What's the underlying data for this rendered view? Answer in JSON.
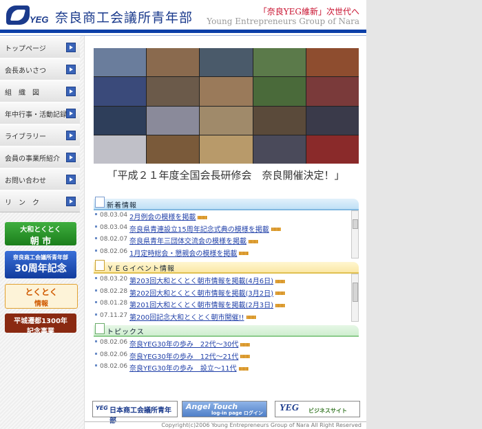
{
  "header": {
    "logo_text": "YEG",
    "site_title": "奈良商工会議所青年部",
    "tagline": "「奈良YEG維新」次世代へ",
    "subtitle": "Young Entrepreneurs Group of Nara"
  },
  "sidebar": {
    "items": [
      {
        "label": "トップページ"
      },
      {
        "label": "会長あいさつ"
      },
      {
        "label": "組　織　図"
      },
      {
        "label": "年中行事・活動記録"
      },
      {
        "label": "ライブラリー"
      },
      {
        "label": "会員の事業所紹介"
      },
      {
        "label": "お問い合わせ"
      },
      {
        "label": "リ　ン　ク"
      }
    ],
    "banners": [
      {
        "line1": "大和とくとく",
        "line2": "朝 市"
      },
      {
        "line1": "奈良商工会議所青年部",
        "line2": "30周年記念"
      },
      {
        "line1": "とくとく",
        "line2": "情報"
      },
      {
        "line1": "平城遷都1300年",
        "line2": "記念事業"
      }
    ]
  },
  "main": {
    "headline": "「平成２１年度全国会長研修会　奈良開催決定！」",
    "news": {
      "title": "新着情報",
      "rows": [
        {
          "date": "08.03.04",
          "text": "2月例会の模様を掲載"
        },
        {
          "date": "08.03.04",
          "text": "奈良県青連設立15周年記念式典の模様を掲載"
        },
        {
          "date": "08.02.07",
          "text": "奈良県青年三団体交流会の模様を掲載"
        },
        {
          "date": "08.02.06",
          "text": "1月定時総会・懇親会の模様を掲載"
        }
      ]
    },
    "events": {
      "title": "ＹＥＧイベント情報",
      "rows": [
        {
          "date": "08.03.20",
          "text": "第203回大和とくとく朝市情報を掲載(4月6日)"
        },
        {
          "date": "08.02.28",
          "text": "第202回大和とくとく朝市情報を掲載(3月2日)"
        },
        {
          "date": "08.01.28",
          "text": "第201回大和とくとく朝市情報を掲載(2月3日)"
        },
        {
          "date": "07.11.27",
          "text": "第200回記念大和とくとく朝市開催!!"
        }
      ]
    },
    "topics": {
      "title": "トピックス",
      "rows": [
        {
          "date": "08.02.06",
          "text": "奈良YEG30年の歩み　22代〜30代"
        },
        {
          "date": "08.02.06",
          "text": "奈良YEG30年の歩み　12代〜21代"
        },
        {
          "date": "08.02.06",
          "text": "奈良YEG30年の歩み　設立〜11代"
        }
      ]
    },
    "bottom_banners": [
      {
        "line1": "日本商工会議所青年部",
        "line2": "YEG"
      },
      {
        "line1": "Angel Touch",
        "line2": "log-in page ログインページ"
      },
      {
        "line1": "YEG",
        "line2": "ビジネスサイト"
      }
    ],
    "footer": "Copyright(c)2006 Young Entrepreneurs Group of Nara All Right Reserved"
  },
  "colors": {
    "brand_blue": "#0b3fa8",
    "tagline_red": "#c8102e",
    "news_head": "#bfe0f6",
    "event_head": "#fbe8a6",
    "topic_head": "#cfeed0"
  }
}
